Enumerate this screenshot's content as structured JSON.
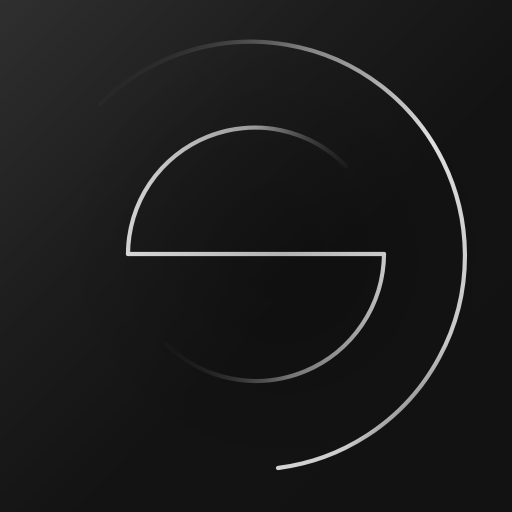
{
  "icon": {
    "name": "app-logo",
    "background": {
      "top_left": "#2f2f2f",
      "bottom_right": "#121212"
    },
    "stroke": {
      "highlight": "#e6e6e6",
      "mid": "#a8a8a8",
      "fade": "#303030"
    }
  }
}
